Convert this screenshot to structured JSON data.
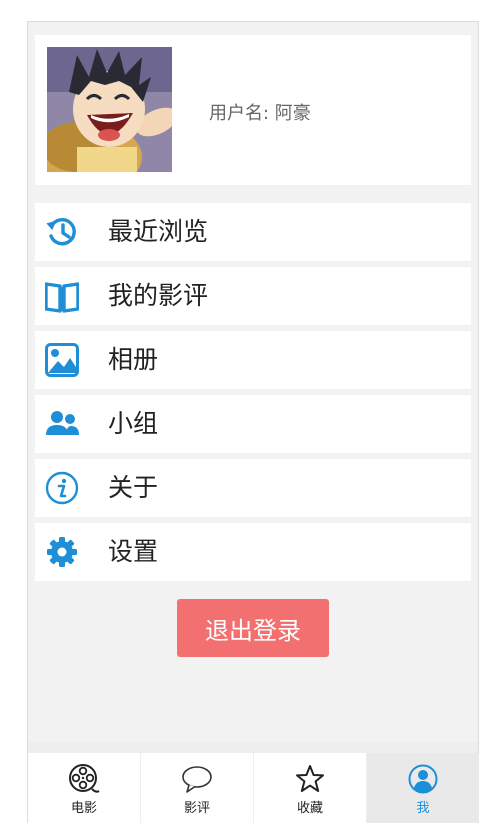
{
  "profile": {
    "username_label": "用户名: 阿豪",
    "avatar": "cartoon-avatar"
  },
  "menu": [
    {
      "label": "最近浏览",
      "icon": "history-icon"
    },
    {
      "label": "我的影评",
      "icon": "book-icon"
    },
    {
      "label": "相册",
      "icon": "image-icon"
    },
    {
      "label": "小组",
      "icon": "group-icon"
    },
    {
      "label": "关于",
      "icon": "info-icon"
    },
    {
      "label": "设置",
      "icon": "gear-icon"
    }
  ],
  "logout_label": "退出登录",
  "tabs": [
    {
      "label": "电影",
      "icon": "film-reel-icon",
      "active": false
    },
    {
      "label": "影评",
      "icon": "comment-icon",
      "active": false
    },
    {
      "label": "收藏",
      "icon": "star-icon",
      "active": false
    },
    {
      "label": "我",
      "icon": "user-icon",
      "active": true
    }
  ],
  "colors": {
    "accent": "#1e8fd6",
    "logout": "#f37070",
    "background": "#f2f2f2"
  }
}
